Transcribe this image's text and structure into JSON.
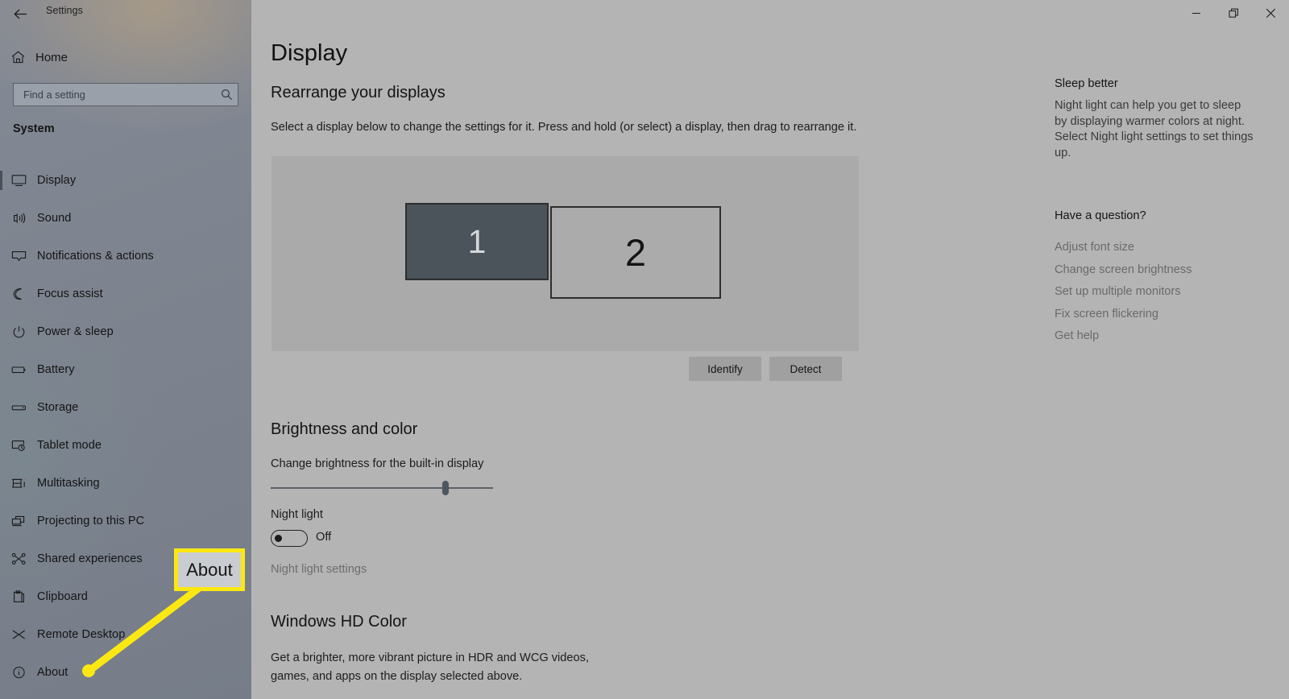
{
  "window": {
    "titlebar": {
      "back_icon": "back-arrow-icon",
      "title": "Settings"
    },
    "controls": {
      "minimize": "–",
      "restore": "restore-icon",
      "close": "✕"
    }
  },
  "sidebar": {
    "home": {
      "label": "Home",
      "icon": "home-icon"
    },
    "search": {
      "placeholder": "Find a setting",
      "icon": "search-icon"
    },
    "section_title": "System",
    "items": [
      {
        "label": "Display",
        "icon": "monitor-icon",
        "selected": true
      },
      {
        "label": "Sound",
        "icon": "speaker-icon",
        "selected": false
      },
      {
        "label": "Notifications & actions",
        "icon": "notification-icon",
        "selected": false
      },
      {
        "label": "Focus assist",
        "icon": "moon-icon",
        "selected": false
      },
      {
        "label": "Power & sleep",
        "icon": "power-icon",
        "selected": false
      },
      {
        "label": "Battery",
        "icon": "battery-icon",
        "selected": false
      },
      {
        "label": "Storage",
        "icon": "storage-icon",
        "selected": false
      },
      {
        "label": "Tablet mode",
        "icon": "tablet-icon",
        "selected": false
      },
      {
        "label": "Multitasking",
        "icon": "multitasking-icon",
        "selected": false
      },
      {
        "label": "Projecting to this PC",
        "icon": "projecting-icon",
        "selected": false
      },
      {
        "label": "Shared experiences",
        "icon": "share-icon",
        "selected": false
      },
      {
        "label": "Clipboard",
        "icon": "clipboard-icon",
        "selected": false
      },
      {
        "label": "Remote Desktop",
        "icon": "remote-desktop-icon",
        "selected": false
      },
      {
        "label": "About",
        "icon": "info-icon",
        "selected": false
      }
    ]
  },
  "main": {
    "page_title": "Display",
    "rearrange": {
      "heading": "Rearrange your displays",
      "description": "Select a display below to change the settings for it. Press and hold (or select) a display, then drag to rearrange it.",
      "monitors": [
        {
          "number": "1",
          "selected": true
        },
        {
          "number": "2",
          "selected": false
        }
      ],
      "identify_button": "Identify",
      "detect_button": "Detect"
    },
    "brightness": {
      "heading": "Brightness and color",
      "slider_label": "Change brightness for the built-in display",
      "slider_value_percent": 77,
      "night_light_label": "Night light",
      "night_light_state": "Off",
      "night_light_on": false,
      "night_light_settings_link": "Night light settings"
    },
    "hd_color": {
      "heading": "Windows HD Color",
      "description": "Get a brighter, more vibrant picture in HDR and WCG videos, games, and apps on the display selected above."
    }
  },
  "right_panel": {
    "tip_heading": "Sleep better",
    "tip_body": "Night light can help you get to sleep by displaying warmer colors at night. Select Night light settings to set things up.",
    "question_heading": "Have a question?",
    "links": [
      "Adjust font size",
      "Change screen brightness",
      "Set up multiple monitors",
      "Fix screen flickering",
      "Get help"
    ]
  },
  "annotation": {
    "callout_label": "About",
    "highlight_color": "#fbe813"
  }
}
